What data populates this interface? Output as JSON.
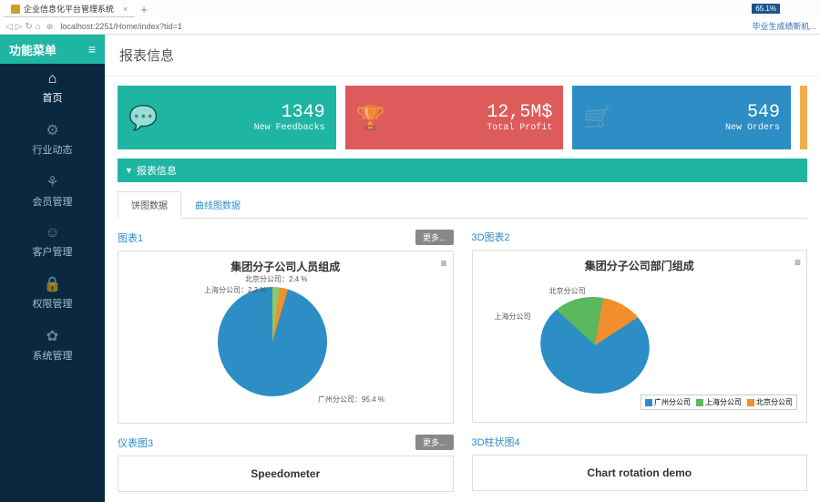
{
  "browser": {
    "tab_title": "企业信息化平台管理系统",
    "url": "localhost:2251/Home/index?tid=1",
    "zoom": "65.1%",
    "bookmark": "毕业生成绩新机..."
  },
  "sidebar": {
    "title": "功能菜单",
    "items": [
      {
        "icon": "⌂",
        "label": "首页"
      },
      {
        "icon": "⚙",
        "label": "行业动态"
      },
      {
        "icon": "⚘",
        "label": "会员管理"
      },
      {
        "icon": "☺",
        "label": "客户管理"
      },
      {
        "icon": "🔒",
        "label": "权限管理"
      },
      {
        "icon": "✿",
        "label": "系统管理"
      }
    ]
  },
  "page": {
    "title": "报表信息"
  },
  "stats": [
    {
      "icon": "💬",
      "value": "1349",
      "label": "New Feedbacks"
    },
    {
      "icon": "🏆",
      "value": "12,5M$",
      "label": "Total Profit"
    },
    {
      "icon": "🛒",
      "value": "549",
      "label": "New Orders"
    }
  ],
  "panel": {
    "title": "报表信息"
  },
  "tabs": [
    {
      "label": "饼图数据",
      "active": true
    },
    {
      "label": "曲线图数据",
      "active": false
    }
  ],
  "charts": {
    "row1": [
      {
        "title": "图表1",
        "more": "更多...",
        "box_title": "集团分子公司人员组成"
      },
      {
        "title": "3D图表2",
        "more": "",
        "box_title": "集团分子公司部门组成"
      }
    ],
    "row2": [
      {
        "title": "仪表图3",
        "more": "更多...",
        "box_title": "Speedometer"
      },
      {
        "title": "3D柱状图4",
        "more": "",
        "box_title": "Chart rotation demo"
      }
    ],
    "pie1_labels": {
      "bj": "北京分公司：2.4 %",
      "sh": "上海分公司：2.2 %",
      "gz": "广州分公司：95.4 %"
    },
    "pie2_labels": {
      "bj": "北京分公司",
      "sh": "上海分公司"
    },
    "legend2": [
      "广州分公司",
      "上海分公司",
      "北京分公司"
    ]
  },
  "chart_data": [
    {
      "type": "pie",
      "title": "集团分子公司人员组成",
      "series": [
        {
          "name": "北京分公司",
          "value": 2.4
        },
        {
          "name": "上海分公司",
          "value": 2.2
        },
        {
          "name": "广州分公司",
          "value": 95.4
        }
      ]
    },
    {
      "type": "pie",
      "title": "集团分子公司部门组成",
      "series": [
        {
          "name": "广州分公司",
          "value": 73
        },
        {
          "name": "上海分公司",
          "value": 15
        },
        {
          "name": "北京分公司",
          "value": 12
        }
      ]
    }
  ]
}
